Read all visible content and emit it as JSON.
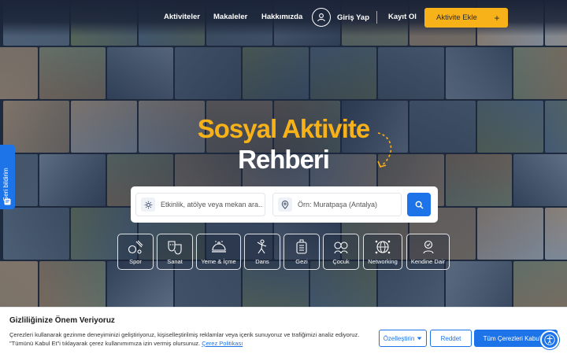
{
  "nav": {
    "links": [
      "Aktiviteler",
      "Makaleler",
      "Hakkımızda"
    ],
    "login": "Giriş Yap",
    "register": "Kayıt Ol",
    "add_activity": "Aktivite Ekle",
    "add_icon": "+"
  },
  "hero": {
    "line1": "Sosyal Aktivite",
    "line2": "Rehberi"
  },
  "search": {
    "query_placeholder": "Etkinlik, atölye veya mekan ara...",
    "location_placeholder": "Örn: Muratpaşa (Antalya)"
  },
  "categories": [
    {
      "label": "Spor",
      "icon": "sports-icon"
    },
    {
      "label": "Sanat",
      "icon": "theater-masks-icon"
    },
    {
      "label": "Yeme & İçme",
      "icon": "food-cloche-icon"
    },
    {
      "label": "Dans",
      "icon": "dance-icon"
    },
    {
      "label": "Gezi",
      "icon": "luggage-icon"
    },
    {
      "label": "Çocuk",
      "icon": "children-icon"
    },
    {
      "label": "Networking",
      "icon": "network-globe-icon"
    },
    {
      "label": "Kendine Dair",
      "icon": "self-care-icon"
    }
  ],
  "feedback": {
    "label": "Geri bildirim"
  },
  "cookie": {
    "title": "Gizliliğinize Önem Veriyoruz",
    "text_line1": "Çerezleri kullanarak gezinme deneyiminizi geliştiriyoruz, kişiselleştirilmiş reklamlar veya içerik sunuyoruz ve trafiğimizi analiz ediyoruz.",
    "text_line2": "\"Tümünü Kabul Et\"i tıklayarak çerez kullanımımıza izin vermiş olursunuz.",
    "policy_link": "Çerez Politikası",
    "customize": "Özelleştirin",
    "reject": "Reddet",
    "accept_all": "Tüm Çerezleri Kabul Et"
  },
  "colors": {
    "accent": "#f7b21a",
    "primary": "#1d74e8"
  }
}
